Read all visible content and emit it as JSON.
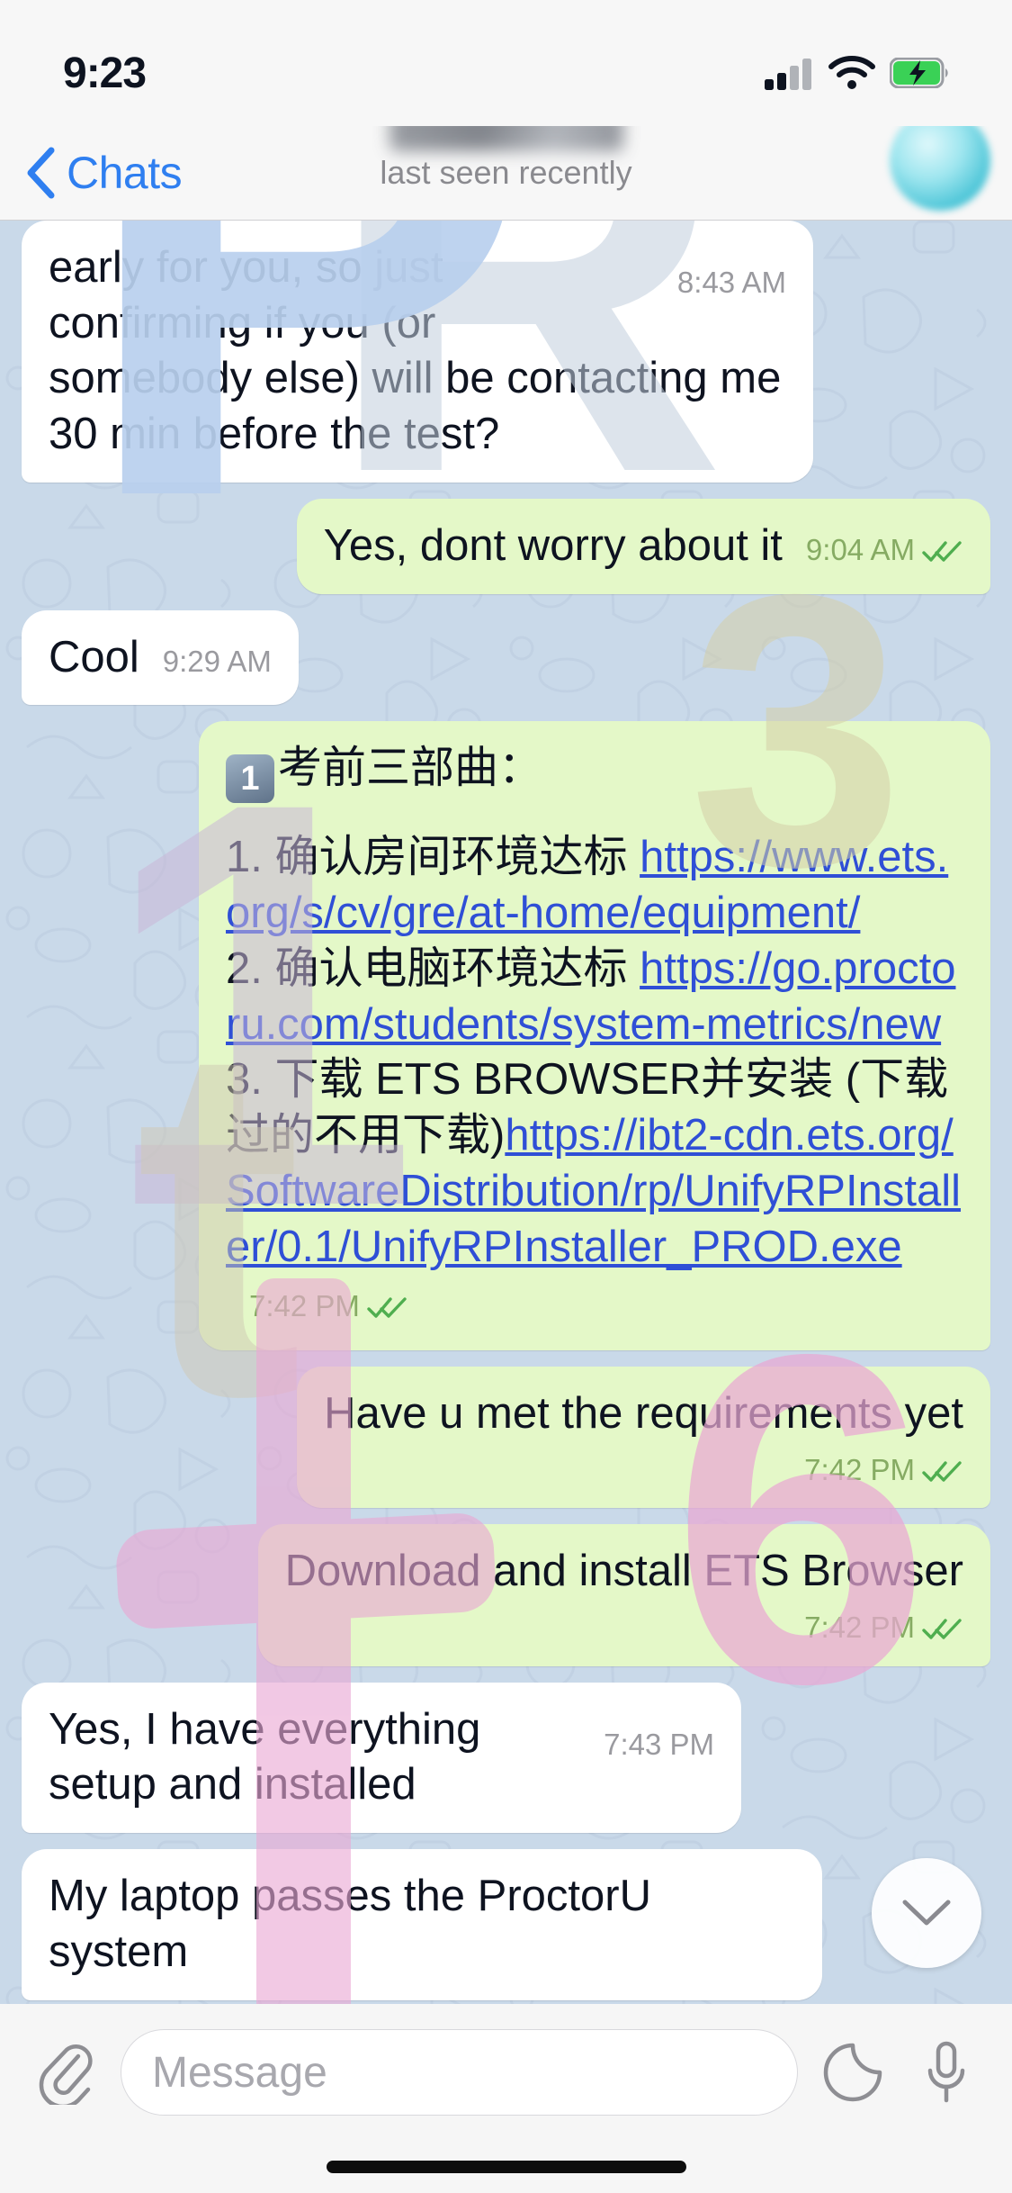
{
  "status_bar": {
    "time": "9:23",
    "icons": [
      "cellular-signal-icon",
      "wifi-icon",
      "battery-charging-icon"
    ]
  },
  "header": {
    "back_label": "Chats",
    "back_icon": "chevron-left-icon",
    "subtitle": "last seen recently",
    "avatar": "contact-avatar"
  },
  "messages": [
    {
      "id": "msg-1",
      "direction": "in",
      "text": "early for you, so just confirming if you (or somebody else) will be contacting me 30 min before the test?",
      "time": "8:43 AM",
      "status": ""
    },
    {
      "id": "msg-2",
      "direction": "out",
      "text": "Yes, dont worry about it",
      "time": "9:04 AM",
      "status": "read"
    },
    {
      "id": "msg-3",
      "direction": "in",
      "text": "Cool",
      "time": "9:29 AM",
      "status": ""
    },
    {
      "id": "msg-4",
      "direction": "out",
      "emoji_badge": "1",
      "heading": "考前三部曲：",
      "lines": [
        {
          "prefix": "1. 确认房间环境达标 ",
          "link": "https://www.ets.org/s/cv/gre/at-home/equipment/"
        },
        {
          "prefix": "2. 确认电脑环境达标 ",
          "link": "https://go.proctoru.com/students/system-metrics/new"
        },
        {
          "prefix": "3. 下载 ETS BROWSER并安装 (下载过的不用下载)",
          "link": "https://ibt2-cdn.ets.org/SoftwareDistribution/rp/UnifyRPInstaller/0.1/UnifyRPInstaller_PROD.exe"
        }
      ],
      "time": "7:42 PM",
      "status": "read"
    },
    {
      "id": "msg-5",
      "direction": "out",
      "text": "Have u met the requirements yet",
      "time": "7:42 PM",
      "status": "read"
    },
    {
      "id": "msg-6",
      "direction": "out",
      "text": "Download and install ETS Browser",
      "time": "7:42 PM",
      "status": "read"
    },
    {
      "id": "msg-7",
      "direction": "in",
      "text": "Yes, I have everything setup and installed",
      "time": "7:43 PM",
      "status": ""
    },
    {
      "id": "msg-8",
      "direction": "in",
      "text": "My laptop passes the ProctorU system",
      "time": "",
      "status": ""
    }
  ],
  "scroll_button": {
    "icon": "chevron-down-icon"
  },
  "input_bar": {
    "attach_icon": "paperclip-icon",
    "placeholder": "Message",
    "sticker_icon": "sticker-icon",
    "mic_icon": "microphone-icon"
  },
  "colors": {
    "outgoing_bubble": "#e4f8c8",
    "incoming_bubble": "#ffffff",
    "link": "#2f4fd6",
    "accent_blue": "#2f7ff0",
    "wallpaper": "#c9d9e9",
    "chrome": "#f7f7f7",
    "battery_green": "#3ad156"
  }
}
